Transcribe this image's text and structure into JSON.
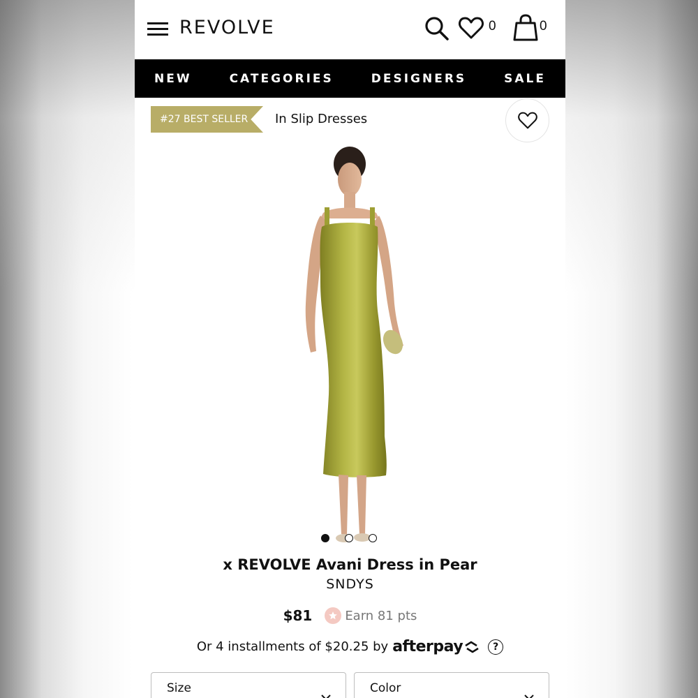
{
  "header": {
    "logo": "REVOLVE",
    "wishlist_count": "0",
    "cart_count": "0"
  },
  "nav": {
    "items": [
      "NEW",
      "CATEGORIES",
      "DESIGNERS",
      "SALE"
    ]
  },
  "badge": {
    "rank_label": "#27 BEST SELLER",
    "category": "In Slip Dresses"
  },
  "carousel": {
    "total": 3,
    "active_index": 0
  },
  "product": {
    "title": "x REVOLVE Avani Dress in Pear",
    "brand": "SNDYS",
    "price": "$81",
    "points": "Earn 81 pts",
    "installments_text": "Or 4 installments of $20.25 by",
    "afterpay_label": "afterpay",
    "help_label": "?"
  },
  "selectors": {
    "size_label": "Size",
    "color_label": "Color"
  },
  "colors": {
    "ribbon": "#b8ad67",
    "dress": "#a3a33a",
    "nav_bg": "#000000"
  },
  "icons": [
    "menu-icon",
    "search-icon",
    "heart-icon",
    "bag-icon",
    "star-icon",
    "afterpay-arrows-icon",
    "chevron-down-icon"
  ]
}
